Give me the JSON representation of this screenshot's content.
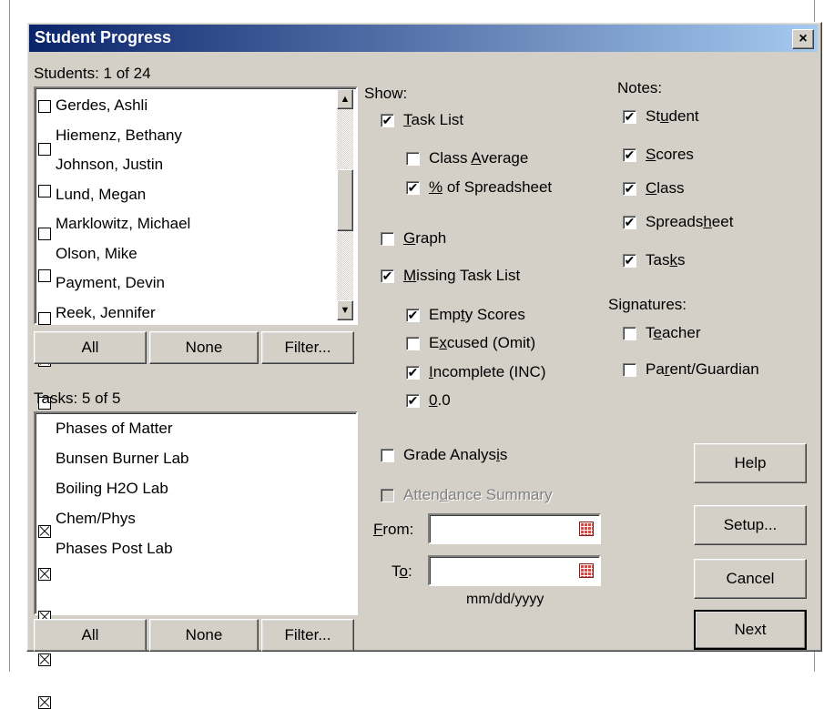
{
  "title": "Student Progress",
  "close_symbol": "×",
  "students": {
    "header": "Students: 1 of 24",
    "items": [
      {
        "name": "Gerdes, Ashli",
        "checked": false
      },
      {
        "name": "Hiemenz, Bethany",
        "checked": false
      },
      {
        "name": "Johnson, Justin",
        "checked": false
      },
      {
        "name": "Lund, Megan",
        "checked": false
      },
      {
        "name": "Marklowitz, Michael",
        "checked": false
      },
      {
        "name": "Olson, Mike",
        "checked": false
      },
      {
        "name": "Payment, Devin",
        "checked": true
      },
      {
        "name": "Reek, Jennifer",
        "checked": false
      }
    ],
    "all": "All",
    "none": "None",
    "filter": "Filter..."
  },
  "tasks": {
    "header": "Tasks: 5 of 5",
    "items": [
      {
        "name": "Phases of Matter",
        "checked": true
      },
      {
        "name": "Bunsen Burner Lab",
        "checked": true
      },
      {
        "name": "Boiling H2O Lab",
        "checked": true
      },
      {
        "name": "Chem/Phys",
        "checked": true
      },
      {
        "name": "Phases Post Lab",
        "checked": true
      }
    ],
    "all": "All",
    "none": "None",
    "filter": "Filter..."
  },
  "show": {
    "header": "Show:",
    "task_list": {
      "label": "Task List",
      "checked": true
    },
    "class_average": {
      "label": "Class Average",
      "checked": false
    },
    "pct_spreadsheet": {
      "label": "% of Spreadsheet",
      "checked": true
    },
    "graph": {
      "label": "Graph",
      "checked": false
    },
    "missing_task_list": {
      "label": "Missing Task List",
      "checked": true
    },
    "empty_scores": {
      "label": "Empty Scores",
      "checked": true
    },
    "excused": {
      "label": "Excused (Omit)",
      "checked": false
    },
    "incomplete": {
      "label": "Incomplete (INC)",
      "checked": true
    },
    "zero": {
      "label": "0.0",
      "checked": true
    },
    "grade_analysis": {
      "label": "Grade Analysis",
      "checked": false
    },
    "attendance_summary": {
      "label": "Attendance Summary",
      "checked": false,
      "disabled": true
    }
  },
  "dates": {
    "from_label": "From:",
    "to_label": "To:",
    "from_value": "",
    "to_value": "",
    "format_hint": "mm/dd/yyyy"
  },
  "notes": {
    "header": "Notes:",
    "student": {
      "label": "Student",
      "checked": true
    },
    "scores": {
      "label": "Scores",
      "checked": true
    },
    "class": {
      "label": "Class",
      "checked": true
    },
    "spreadsheet": {
      "label": "Spreadsheet",
      "checked": true
    },
    "tasks": {
      "label": "Tasks",
      "checked": true
    }
  },
  "signatures": {
    "header": "Signatures:",
    "teacher": {
      "label": "Teacher",
      "checked": false
    },
    "parent": {
      "label": "Parent/Guardian",
      "checked": false
    }
  },
  "buttons": {
    "help": "Help",
    "setup": "Setup...",
    "cancel": "Cancel",
    "next": "Next"
  },
  "check_glyph": "✔",
  "icons": {
    "scroll_up": "up-arrow-icon",
    "scroll_down": "down-arrow-icon",
    "calendar": "calendar-icon"
  }
}
